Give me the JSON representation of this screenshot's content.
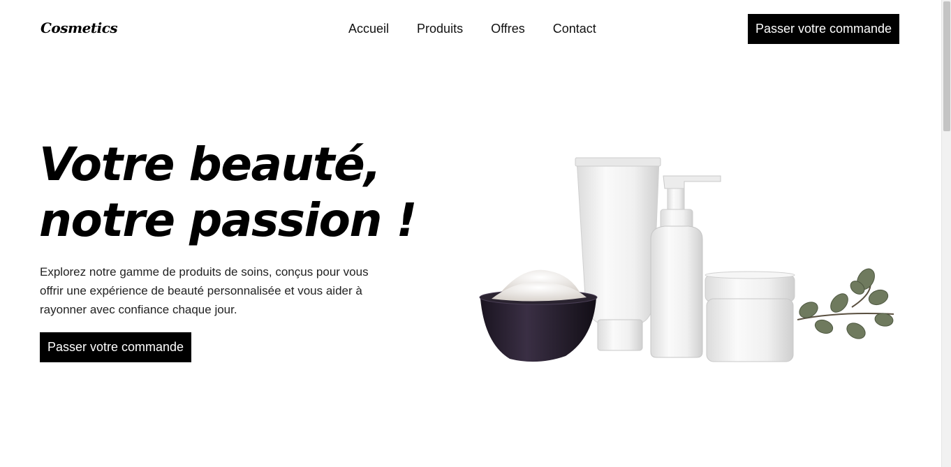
{
  "header": {
    "logo": "Cosmetics",
    "nav": [
      "Accueil",
      "Produits",
      "Offres",
      "Contact"
    ],
    "cta": "Passer votre commande"
  },
  "hero": {
    "title_line1": "Votre beauté,",
    "title_line2": "notre passion !",
    "description": "Explorez notre gamme de produits de soins, conçus pour vous offrir une expérience de beauté personnalisée et vous aider à rayonner avec confiance chaque jour.",
    "cta": "Passer votre commande"
  },
  "colors": {
    "primary": "#000000",
    "background": "#ffffff",
    "text": "#222222"
  }
}
